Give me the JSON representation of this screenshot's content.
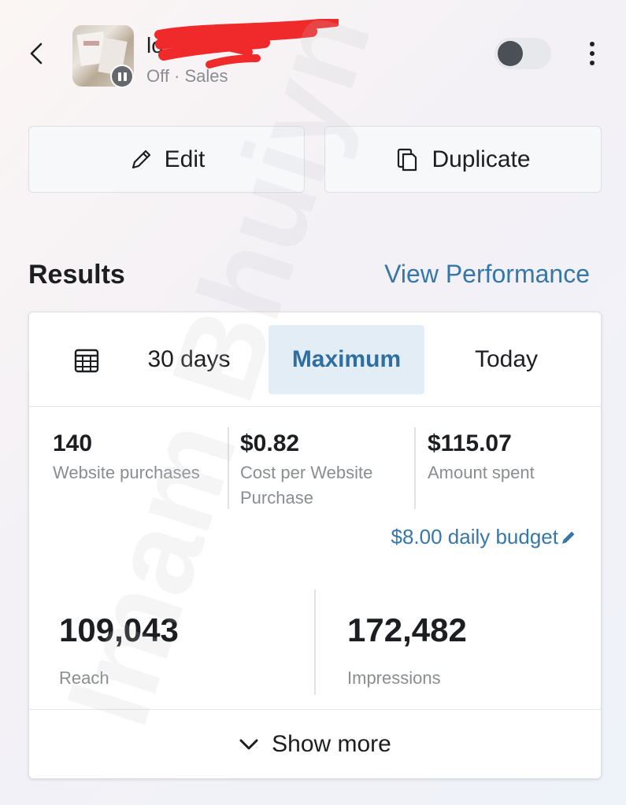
{
  "header": {
    "campaign_name": "lo",
    "status_text": "Off · Sales",
    "toggle_on": false
  },
  "actions": {
    "edit_label": "Edit",
    "duplicate_label": "Duplicate"
  },
  "results": {
    "title": "Results",
    "view_performance": "View Performance"
  },
  "date_range": {
    "options": [
      "30 days",
      "Maximum",
      "Today"
    ],
    "selected": "Maximum"
  },
  "metrics": [
    {
      "value": "140",
      "label": "Website purchases"
    },
    {
      "value": "$0.82",
      "label": "Cost per Website Purchase"
    },
    {
      "value": "$115.07",
      "label": "Amount spent"
    }
  ],
  "budget_text": "$8.00 daily budget",
  "big_metrics": [
    {
      "value": "109,043",
      "label": "Reach"
    },
    {
      "value": "172,482",
      "label": "Impressions"
    }
  ],
  "show_more_label": "Show more",
  "watermark_text": "Imam Bhuiyn",
  "colors": {
    "accent_blue": "#3578a8",
    "selected_bg": "#e3edf6",
    "redaction_red": "#f0292a"
  }
}
